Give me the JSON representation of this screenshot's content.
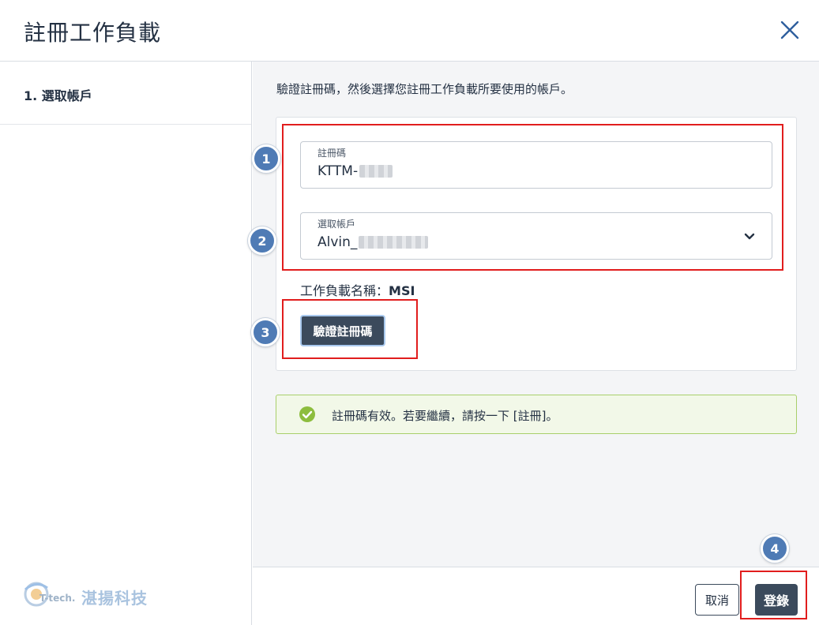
{
  "dialog": {
    "title": "註冊工作負載",
    "close_icon": "close-icon"
  },
  "sidebar": {
    "steps": [
      {
        "label": "1. 選取帳戶"
      }
    ],
    "logo": {
      "brand_en": "T-tech.",
      "brand_zh": "湛揚科技"
    }
  },
  "main": {
    "intro": "驗證註冊碼，然後選擇您註冊工作負載所要使用的帳戶。",
    "registration_code": {
      "label": "註冊碼",
      "value": "KTTM-"
    },
    "account": {
      "label": "選取帳戶",
      "value": "Alvin_"
    },
    "workload_name_label": "工作負載名稱：",
    "workload_name_value": "MSI",
    "verify_button": "驗證註冊碼",
    "alert": {
      "text": "註冊碼有效。若要繼續，請按一下 [註冊]。",
      "icon": "check-circle-icon"
    }
  },
  "footer": {
    "cancel_button": "取消",
    "register_button": "登錄"
  },
  "annotations": {
    "badges": [
      "1",
      "2",
      "3",
      "4"
    ]
  },
  "colors": {
    "primary": "#3b4a5c",
    "success": "#8dbd3e",
    "annotation_red": "#e11d1d",
    "badge_blue": "#4f7bb5"
  }
}
